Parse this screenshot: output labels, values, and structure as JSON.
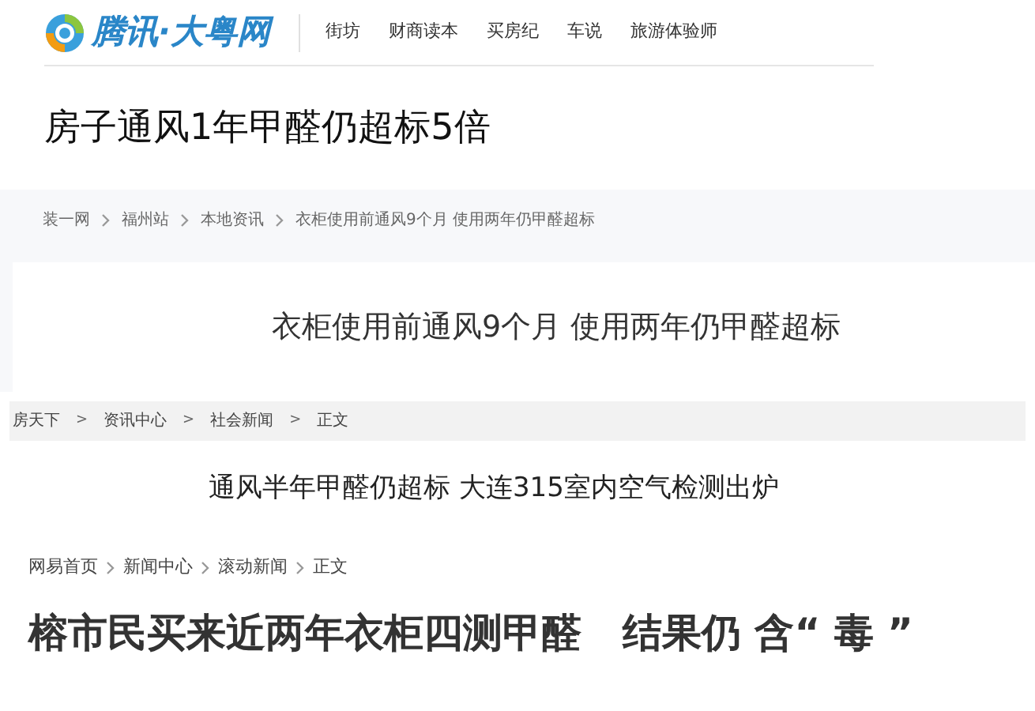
{
  "tencent": {
    "logo_text": "腾讯·大粤网",
    "nav": [
      "街坊",
      "财商读本",
      "买房纪",
      "车说",
      "旅游体验师"
    ],
    "headline": "房子通风1年甲醛仍超标5倍"
  },
  "zhuang": {
    "breadcrumb": [
      "装一网",
      "福州站",
      "本地资讯",
      "衣柜使用前通风9个月 使用两年仍甲醛超标"
    ],
    "headline": "衣柜使用前通风9个月 使用两年仍甲醛超标"
  },
  "fang": {
    "breadcrumb": [
      "房天下",
      "资讯中心",
      "社会新闻",
      "正文"
    ],
    "separator": ">",
    "headline": "通风半年甲醛仍超标 大连315室内空气检测出炉"
  },
  "netease": {
    "breadcrumb": [
      "网易首页",
      "新闻中心",
      "滚动新闻",
      "正文"
    ],
    "headline": [
      "榕市民买来近两年衣柜四测甲醛",
      "结果仍 含“ 毒 ”"
    ]
  }
}
